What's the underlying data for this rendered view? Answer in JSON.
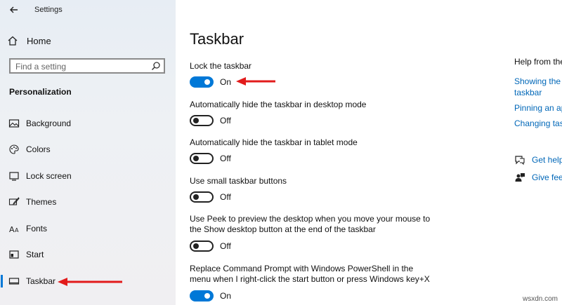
{
  "window": {
    "title": "Settings"
  },
  "sidebar": {
    "home_label": "Home",
    "search_placeholder": "Find a setting",
    "section_label": "Personalization",
    "items": [
      {
        "label": "Background",
        "icon": "picture-icon"
      },
      {
        "label": "Colors",
        "icon": "palette-icon"
      },
      {
        "label": "Lock screen",
        "icon": "lock-screen-icon"
      },
      {
        "label": "Themes",
        "icon": "brush-icon"
      },
      {
        "label": "Fonts",
        "icon": "font-icon"
      },
      {
        "label": "Start",
        "icon": "start-icon"
      },
      {
        "label": "Taskbar",
        "icon": "taskbar-icon",
        "selected": true
      }
    ]
  },
  "main": {
    "title": "Taskbar",
    "settings": [
      {
        "label": "Lock the taskbar",
        "state": "On"
      },
      {
        "label": "Automatically hide the taskbar in desktop mode",
        "state": "Off"
      },
      {
        "label": "Automatically hide the taskbar in tablet mode",
        "state": "Off"
      },
      {
        "label": "Use small taskbar buttons",
        "state": "Off"
      },
      {
        "label": "Use Peek to preview the desktop when you move your mouse to the Show desktop button at the end of the taskbar",
        "state": "Off"
      },
      {
        "label": "Replace Command Prompt with Windows PowerShell in the menu when I right-click the start button or press Windows key+X",
        "state": "On"
      }
    ]
  },
  "help": {
    "title": "Help from the",
    "links": [
      "Showing the",
      "taskbar",
      "Pinning an ap",
      "Changing tas"
    ],
    "get_help": "Get help",
    "give_feedback": "Give feec"
  },
  "watermark": "wsxdn.com",
  "colors": {
    "accent": "#0078d7",
    "link": "#0067b8",
    "arrow": "#e21b1b"
  }
}
